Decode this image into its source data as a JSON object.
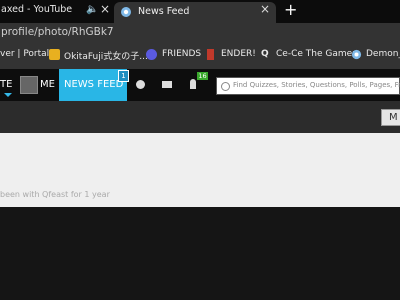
{
  "browser": {
    "tabs": [
      {
        "title": "axed - YouTube",
        "audio_icon": "speaker-icon",
        "close": "×"
      },
      {
        "title": "News Feed",
        "close": "×",
        "active": true
      }
    ],
    "new_tab": "+",
    "url": "profile/photo/RhGBk7",
    "bookmarks": [
      {
        "label": "ver | Portal"
      },
      {
        "label": "OkitaFuji式女の子...",
        "icon_color": "#e8b020"
      },
      {
        "label": "FRIENDS",
        "icon_color": "#5a5ae0"
      },
      {
        "label": "ENDER!",
        "icon_color": "#c0392b"
      },
      {
        "label": "Ce-Ce The Gamer"
      },
      {
        "label": "Demon_C"
      }
    ]
  },
  "site": {
    "nav": {
      "te_label": "TE",
      "me_label": "ME",
      "news_feed_label": "NEWS FEED",
      "news_feed_badge": "1",
      "notifications_badge": "16"
    },
    "search_placeholder": "Find Quizzes, Stories, Questions, Polls, Pages, Frie",
    "accent": "#29b6e6"
  },
  "profile": {
    "membership_text": "been with Qfeast for 1 year"
  }
}
